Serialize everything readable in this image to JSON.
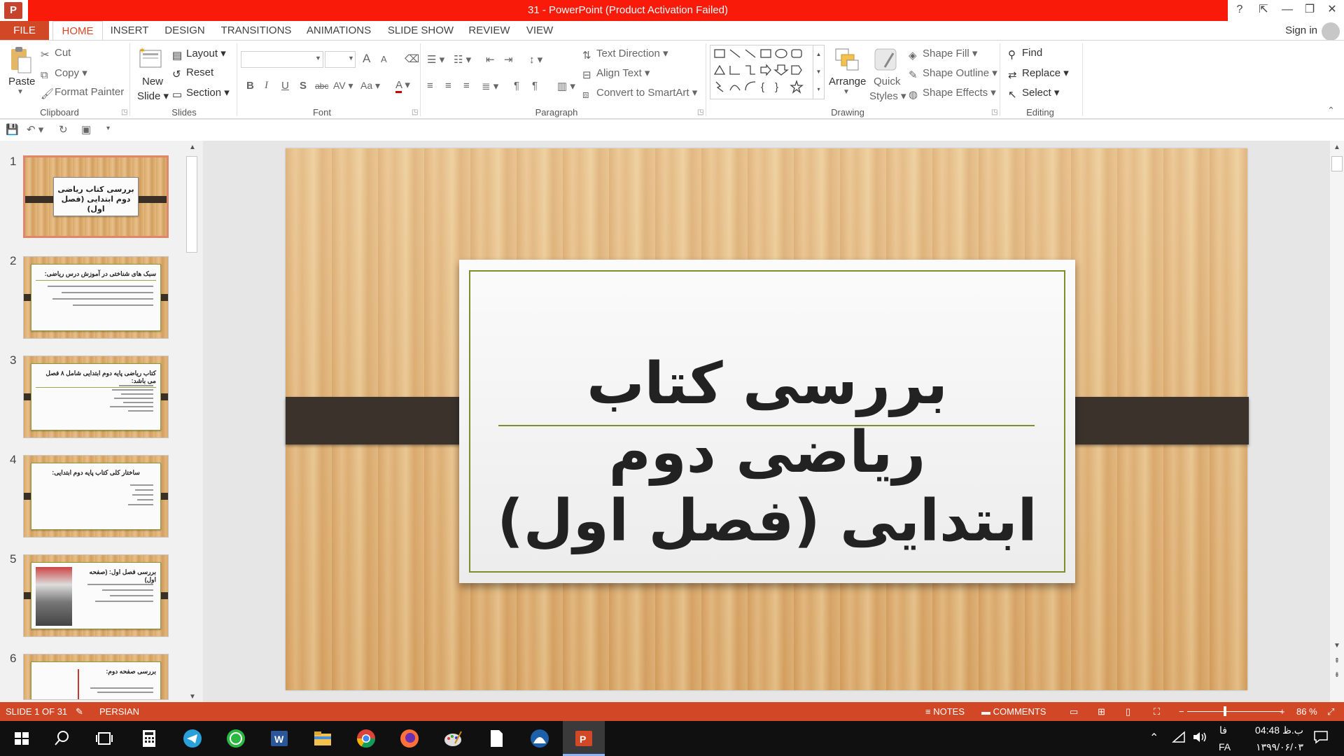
{
  "window": {
    "title": "31  -  PowerPoint (Product Activation Failed)",
    "app_icon_letter": "P",
    "help": "?",
    "ribbon_display": "⇱",
    "minimize": "—",
    "restore": "❐",
    "close": "✕"
  },
  "tabs": [
    "FILE",
    "HOME",
    "INSERT",
    "DESIGN",
    "TRANSITIONS",
    "ANIMATIONS",
    "SLIDE SHOW",
    "REVIEW",
    "VIEW"
  ],
  "account": {
    "signin": "Sign in"
  },
  "ribbon": {
    "clipboard": {
      "label": "Clipboard",
      "paste": "Paste",
      "cut": "Cut",
      "copy": "Copy",
      "format_painter": "Format Painter"
    },
    "slides": {
      "label": "Slides",
      "new_slide": "New",
      "new_slide_2": "Slide",
      "layout": "Layout",
      "reset": "Reset",
      "section": "Section"
    },
    "font": {
      "label": "Font",
      "bold": "B",
      "italic": "I",
      "underline": "U",
      "shadow": "S",
      "strike": "abc",
      "spacing": "AV",
      "case": "Aa",
      "color": "A",
      "grow": "A",
      "shrink": "A"
    },
    "paragraph": {
      "label": "Paragraph",
      "text_direction": "Text Direction",
      "align_text": "Align Text",
      "convert_smartart": "Convert to SmartArt"
    },
    "drawing": {
      "label": "Drawing",
      "arrange": "Arrange",
      "quick_styles": "Quick",
      "quick_styles_2": "Styles",
      "shape_fill": "Shape Fill",
      "shape_outline": "Shape Outline",
      "shape_effects": "Shape Effects"
    },
    "editing": {
      "label": "Editing",
      "find": "Find",
      "replace": "Replace",
      "select": "Select"
    }
  },
  "thumbnails": [
    {
      "num": "1",
      "title": "بررسی کتاب ریاضی دوم ابتدایی (فصل اول)",
      "selected": true
    },
    {
      "num": "2",
      "title": "سبک های شناختی در آموزش درس ریاضی:"
    },
    {
      "num": "3",
      "title": "کتاب ریاضی پایه دوم ابتدایی شامل ۸ فصل می باشد:"
    },
    {
      "num": "4",
      "title": "ساختار کلی کتاب پایه دوم ابتدایی:"
    },
    {
      "num": "5",
      "title": "بررسی فصل اول:      (صفحه اول)"
    },
    {
      "num": "6",
      "title": "بررسی صفحه دوم:"
    }
  ],
  "slide": {
    "title_line1": "بررسی کتاب ریاضی دوم",
    "title_line2": "ابتدایی (فصل اول)",
    "accent_color": "#7f8e2a"
  },
  "status": {
    "slide_info": "SLIDE 1 OF 31",
    "language": "PERSIAN",
    "notes": "NOTES",
    "comments": "COMMENTS",
    "zoom": "86 %",
    "zoom_minus": "−",
    "zoom_plus": "+"
  },
  "tray": {
    "lang1": "فا",
    "lang2": "FA",
    "time": "04:48 ب.ظ",
    "date": "۱۳۹۹/۰۶/۰۳"
  },
  "colors": {
    "accent": "#d24726",
    "titlebar": "#f91a0a"
  }
}
